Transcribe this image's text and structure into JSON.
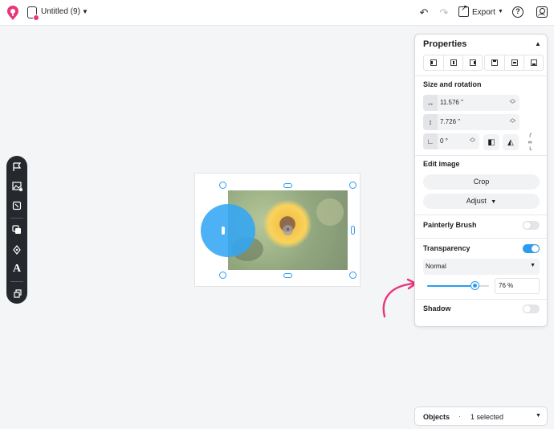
{
  "header": {
    "doc_title": "Untitled (9)",
    "export_label": "Export"
  },
  "toolbar": {
    "tools": [
      "flags-tool",
      "image-tool",
      "shape-tool",
      "duplicate-tool",
      "pen-tool",
      "text-tool",
      "templates-tool"
    ],
    "text_tool_glyph": "A"
  },
  "canvas": {
    "center_marker": "×"
  },
  "properties": {
    "title": "Properties",
    "size_rotation_title": "Size and rotation",
    "width": "11.576 \"",
    "height": "7.726 \"",
    "rotation": "0 °",
    "edit_image_title": "Edit image",
    "crop_label": "Crop",
    "adjust_label": "Adjust",
    "painterly_brush_label": "Painterly Brush",
    "painterly_brush_on": false,
    "transparency_label": "Transparency",
    "transparency_on": true,
    "blend_mode": "Normal",
    "transparency_value": "76 %",
    "transparency_level": 0.76,
    "shadow_label": "Shadow",
    "shadow_on": false
  },
  "objects": {
    "label": "Objects",
    "separator": "·",
    "count": "1 selected"
  },
  "colors": {
    "accent": "#2b9cf0",
    "arrow": "#e8357c",
    "toolbar": "#25282d",
    "shape": "#33a6f4"
  }
}
